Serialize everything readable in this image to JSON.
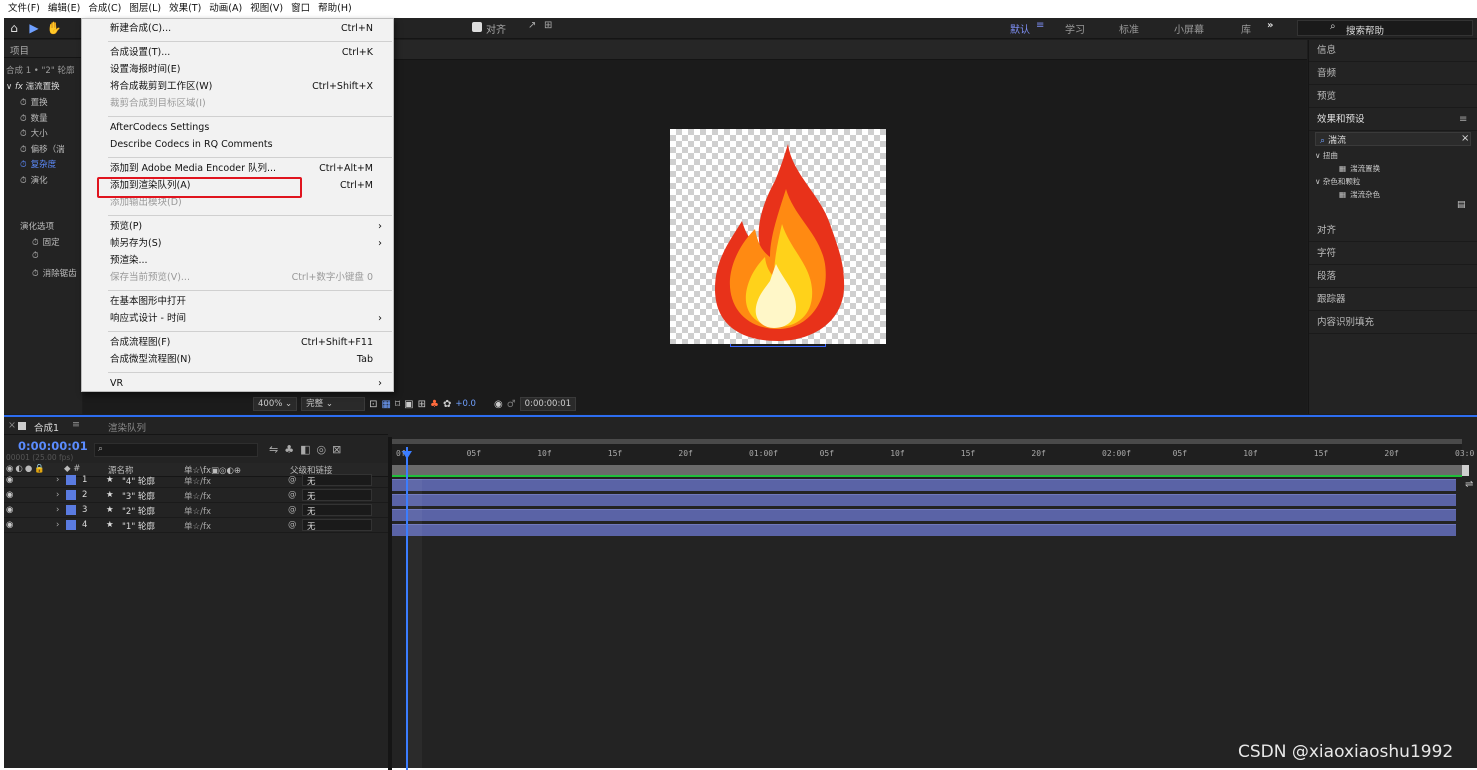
{
  "menubar": [
    "文件(F)",
    "编辑(E)",
    "合成(C)",
    "图层(L)",
    "效果(T)",
    "动画(A)",
    "视图(V)",
    "窗口",
    "帮助(H)"
  ],
  "toolbar": {
    "align_label": "对齐",
    "workspaces": [
      {
        "label": "默认",
        "active": true
      },
      {
        "label": "学习",
        "active": false
      },
      {
        "label": "标准",
        "active": false
      },
      {
        "label": "小屏幕",
        "active": false
      },
      {
        "label": "库",
        "active": false
      }
    ],
    "search_help": "搜索帮助"
  },
  "project": {
    "tab": "项目",
    "header": "合成 1 • \"2\" 轮廓",
    "effect": "湍流置换",
    "props": [
      "置换",
      "数量",
      "大小",
      "偏移（湍",
      "复杂度",
      "演化"
    ],
    "props2": [
      "演化选项",
      "固定",
      "",
      "消除锯齿"
    ]
  },
  "composition_menu": {
    "groups": [
      [
        {
          "label": "新建合成(C)...",
          "shortcut": "Ctrl+N"
        }
      ],
      [
        {
          "label": "合成设置(T)...",
          "shortcut": "Ctrl+K"
        },
        {
          "label": "设置海报时间(E)",
          "shortcut": ""
        },
        {
          "label": "将合成裁剪到工作区(W)",
          "shortcut": "Ctrl+Shift+X"
        },
        {
          "label": "裁剪合成到目标区域(I)",
          "shortcut": "",
          "disabled": true
        }
      ],
      [
        {
          "label": "AfterCodecs Settings",
          "shortcut": ""
        },
        {
          "label": "Describe Codecs in RQ Comments",
          "shortcut": ""
        }
      ],
      [
        {
          "label": "添加到 Adobe Media Encoder 队列...",
          "shortcut": "Ctrl+Alt+M"
        },
        {
          "label": "添加到渲染队列(A)",
          "shortcut": "Ctrl+M",
          "highlighted": true
        },
        {
          "label": "添加输出模块(D)",
          "shortcut": "",
          "disabled": true
        }
      ],
      [
        {
          "label": "预览(P)",
          "submenu": true
        },
        {
          "label": "帧另存为(S)",
          "submenu": true
        },
        {
          "label": "预渲染...",
          "shortcut": ""
        },
        {
          "label": "保存当前预览(V)...",
          "shortcut": "Ctrl+数字小键盘 0",
          "disabled": true
        }
      ],
      [
        {
          "label": "在基本图形中打开",
          "shortcut": ""
        },
        {
          "label": "响应式设计 - 时间",
          "submenu": true
        }
      ],
      [
        {
          "label": "合成流程图(F)",
          "shortcut": "Ctrl+Shift+F11"
        },
        {
          "label": "合成微型流程图(N)",
          "shortcut": "Tab"
        }
      ],
      [
        {
          "label": "VR",
          "submenu": true
        }
      ]
    ]
  },
  "viewer": {
    "zoom": "400%",
    "quality": "完整",
    "exposure": "+0.0",
    "timecode": "0:00:00:01"
  },
  "right_panels": [
    "信息",
    "音频",
    "预览",
    "效果和预设",
    "对齐",
    "字符",
    "段落",
    "跟踪器",
    "内容识别填充"
  ],
  "effects_search": "湍流",
  "effects_tree": [
    {
      "label": "扭曲",
      "children": [
        "湍流置换"
      ]
    },
    {
      "label": "杂色和颗粒",
      "children": [
        "湍流杂色"
      ]
    }
  ],
  "timeline": {
    "tabs": [
      "合成1",
      "渲染队列"
    ],
    "timecode": "0:00:00:01",
    "fps": "00001 (25.00 fps)",
    "col_source": "源名称",
    "col_switches": "单☆\\fx▣◎◐⊕",
    "col_parent": "父级和链接",
    "ruler": [
      "0f",
      "05f",
      "10f",
      "15f",
      "20f",
      "01:00f",
      "05f",
      "10f",
      "15f",
      "20f",
      "02:00f",
      "05f",
      "10f",
      "15f",
      "20f",
      "03:0"
    ],
    "layers": [
      {
        "num": "1",
        "name": "\"4\" 轮廓",
        "parent": "无"
      },
      {
        "num": "2",
        "name": "\"3\" 轮廓",
        "parent": "无"
      },
      {
        "num": "3",
        "name": "\"2\" 轮廓",
        "parent": "无"
      },
      {
        "num": "4",
        "name": "\"1\" 轮廓",
        "parent": "无"
      }
    ]
  },
  "watermark": "CSDN @xiaoxiaoshu1992"
}
